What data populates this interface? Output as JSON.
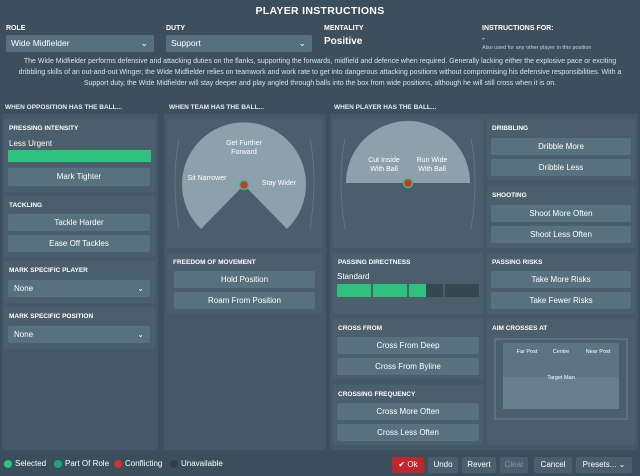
{
  "title": "PLAYER INSTRUCTIONS",
  "role": {
    "label": "ROLE",
    "value": "Wide Midfielder"
  },
  "duty": {
    "label": "DUTY",
    "value": "Support"
  },
  "mentality": {
    "label": "MENTALITY",
    "value": "Positive"
  },
  "instructions_for": {
    "label": "INSTRUCTIONS FOR:",
    "value": "-",
    "note": "Also used for any other player in this position"
  },
  "description": "The Wide Midfielder performs defensive and attacking duties on the flanks, supporting the forwards, midfield and defence when required. Generally lacking either the explosive pace or exciting dribbling skills of an out-and-out Winger, the Wide Midfielder relies on teamwork and work rate to get into dangerous attacking positions without compromising his defensive responsibilities. With a Support duty, the Wide Midfielder will stay deeper and play angled through balls into the box from wide positions, although he will still cross when it is on.",
  "sections": {
    "opposition": "WHEN OPPOSITION HAS THE BALL...",
    "team": "WHEN TEAM HAS THE BALL...",
    "player": "WHEN PLAYER HAS THE BALL..."
  },
  "pressing": {
    "title": "PRESSING INTENSITY",
    "value": "Less Urgent",
    "level": 1.0,
    "button": "Mark Tighter"
  },
  "tackling": {
    "title": "TACKLING",
    "buttons": [
      "Tackle Harder",
      "Ease Off Tackles"
    ]
  },
  "mark_player": {
    "title": "MARK SPECIFIC PLAYER",
    "value": "None"
  },
  "mark_position": {
    "title": "MARK SPECIFIC POSITION",
    "value": "None"
  },
  "team_pitch": {
    "top": "Get Further Forward",
    "left": "Sit Narrower",
    "right": "Stay Wider"
  },
  "freedom": {
    "title": "FREEDOM OF MOVEMENT",
    "buttons": [
      "Hold Position",
      "Roam From Position"
    ]
  },
  "player_pitch": {
    "left": "Cut Inside With Ball",
    "right": "Run Wide With Ball"
  },
  "dribbling": {
    "title": "DRIBBLING",
    "buttons": [
      "Dribble More",
      "Dribble Less"
    ]
  },
  "shooting": {
    "title": "SHOOTING",
    "buttons": [
      "Shoot More Often",
      "Shoot Less Often"
    ]
  },
  "passing_dir": {
    "title": "PASSING DIRECTNESS",
    "value": "Standard",
    "segments_total": 4,
    "segments_filled": 2.5
  },
  "passing_risks": {
    "title": "PASSING RISKS",
    "buttons": [
      "Take More Risks",
      "Take Fewer Risks"
    ]
  },
  "cross_from": {
    "title": "CROSS FROM",
    "buttons": [
      "Cross From Deep",
      "Cross From Byline"
    ]
  },
  "aim_crosses": {
    "title": "AIM CROSSES AT",
    "targets": [
      "Far Post",
      "Centre",
      "Near Post",
      "Target Man"
    ]
  },
  "crossing_freq": {
    "title": "CROSSING FREQUENCY",
    "buttons": [
      "Cross More Often",
      "Cross Less Often"
    ]
  },
  "legend": {
    "selected": "Selected",
    "part_of_role": "Part Of Role",
    "conflicting": "Conflicting",
    "unavailable": "Unavailable"
  },
  "footer": {
    "ok": "Ok",
    "undo": "Undo",
    "revert": "Revert",
    "clear": "Clear",
    "cancel": "Cancel",
    "presets": "Presets..."
  },
  "colors": {
    "selected": "#2ec27e",
    "part_of_role": "#1aa77a",
    "conflicting": "#d0342c",
    "unavailable": "#3a3a44",
    "ok_button": "#c0272d"
  }
}
